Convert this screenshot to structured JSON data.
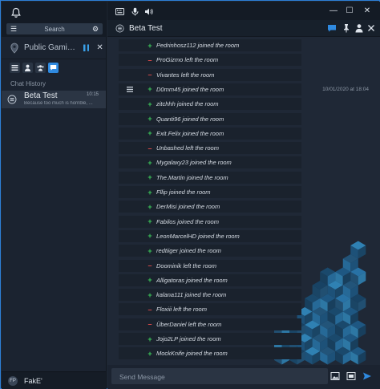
{
  "sidebar": {
    "search_placeholder": "Search",
    "server_name": "Public Gaming ...",
    "server_signal": "▌▍",
    "section_label": "Chat History",
    "chat": {
      "title": "Beta Test",
      "time": "10:15",
      "preview": "Because too much is horrible, ..."
    },
    "user": {
      "avatar": "FP",
      "name": "FakE'"
    }
  },
  "window": {
    "minimize": "—",
    "maximize": "☐",
    "close": "✕"
  },
  "header": {
    "title": "Beta Test"
  },
  "messages": [
    {
      "type": "join",
      "text": "Pedrinhosz112 joined the room"
    },
    {
      "type": "leave",
      "text": "ProGizmo left the room"
    },
    {
      "type": "leave",
      "text": "Vivantes left the room"
    },
    {
      "type": "join",
      "text": "D0mm45 joined the room",
      "time": "10/01/2020 at 18:04",
      "line_icon": true
    },
    {
      "type": "join",
      "text": "zitchhh joined the room"
    },
    {
      "type": "join",
      "text": "Quanti96 joined the room"
    },
    {
      "type": "join",
      "text": "Exit.Felix joined the room"
    },
    {
      "type": "leave",
      "text": "Unbashed left the room"
    },
    {
      "type": "join",
      "text": "Mygalaxy23 joined the room"
    },
    {
      "type": "join",
      "text": "The.Martin joined the room"
    },
    {
      "type": "join",
      "text": "Fllip joined the room"
    },
    {
      "type": "join",
      "text": "DerMisi joined the room"
    },
    {
      "type": "join",
      "text": "Fabilos joined the room"
    },
    {
      "type": "join",
      "text": "LeonMarcelHD joined the room"
    },
    {
      "type": "join",
      "text": "redtiiger joined the room"
    },
    {
      "type": "leave",
      "text": "Doominik left the room"
    },
    {
      "type": "join",
      "text": "Alligatoras joined the room"
    },
    {
      "type": "join",
      "text": "kalana111 joined the room"
    },
    {
      "type": "leave",
      "text": "Floxiii left the room"
    },
    {
      "type": "leave",
      "text": "ÜberDaniel left the room"
    },
    {
      "type": "join",
      "text": "Jojo2LP joined the room"
    },
    {
      "type": "join",
      "text": "MockKnife joined the room"
    }
  ],
  "composer": {
    "placeholder": "Send Message"
  },
  "colors": {
    "accent": "#2f8ae0",
    "join": "#3cc55a",
    "leave": "#e04b4b"
  }
}
